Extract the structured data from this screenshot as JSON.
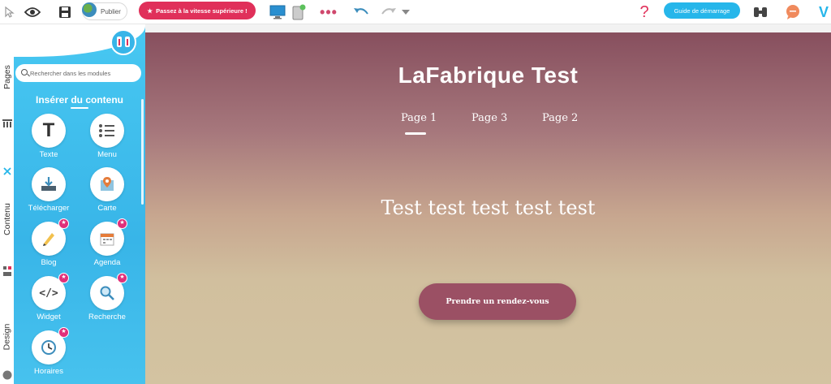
{
  "toolbar": {
    "publish_label": "Publier",
    "upgrade_label": "Passez à la vitesse supérieure !",
    "guide_label": "Guide de démarrage",
    "help_icon": "question-icon",
    "more_icon": "more-dots-icon"
  },
  "tabs": {
    "pages": "Pages",
    "contenu": "Contenu",
    "design": "Design"
  },
  "panel": {
    "search_placeholder": "Rechercher dans les modules",
    "title": "Insérer du contenu",
    "modules": [
      {
        "label": "Texte",
        "icon": "text-icon",
        "premium": false
      },
      {
        "label": "Menu",
        "icon": "menu-list-icon",
        "premium": false
      },
      {
        "label": "Télécharger",
        "icon": "download-icon",
        "premium": false
      },
      {
        "label": "Carte",
        "icon": "map-icon",
        "premium": false
      },
      {
        "label": "Blog",
        "icon": "blog-icon",
        "premium": true
      },
      {
        "label": "Agenda",
        "icon": "calendar-icon",
        "premium": true
      },
      {
        "label": "Widget",
        "icon": "code-icon",
        "premium": true
      },
      {
        "label": "Recherche",
        "icon": "search-icon",
        "premium": true
      },
      {
        "label": "Horaires",
        "icon": "clock-icon",
        "premium": true
      }
    ]
  },
  "site": {
    "title": "LaFabrique Test",
    "nav": [
      "Page 1",
      "Page 3",
      "Page 2"
    ],
    "hero": "Test test test test test",
    "cta": "Prendre un rendez-vous"
  },
  "colors": {
    "accent": "#26b6ea",
    "upgrade": "#e0305a",
    "cta": "#9b5064"
  }
}
